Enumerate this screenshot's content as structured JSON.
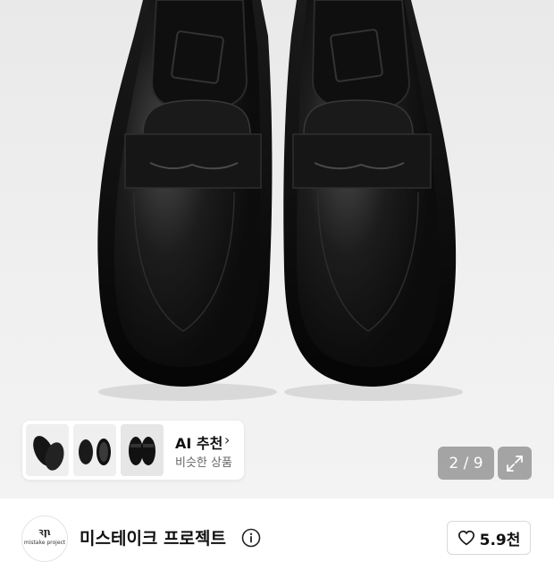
{
  "gallery": {
    "counter": "2 / 9",
    "current_index": 2,
    "total": 9
  },
  "ai_recommend": {
    "title": "AI 추천",
    "subtitle": "비슷한 상품",
    "chevron": "chevron-right-icon"
  },
  "brand": {
    "logo_mark": "ꝛꞃ",
    "logo_text": "mistake project",
    "name": "미스테이크 프로젝트",
    "info_icon": "info-icon"
  },
  "like": {
    "icon": "heart-icon",
    "count": "5.9천"
  },
  "colors": {
    "shoe": "#141414",
    "overlay": "rgba(0,0,0,0.32)"
  }
}
